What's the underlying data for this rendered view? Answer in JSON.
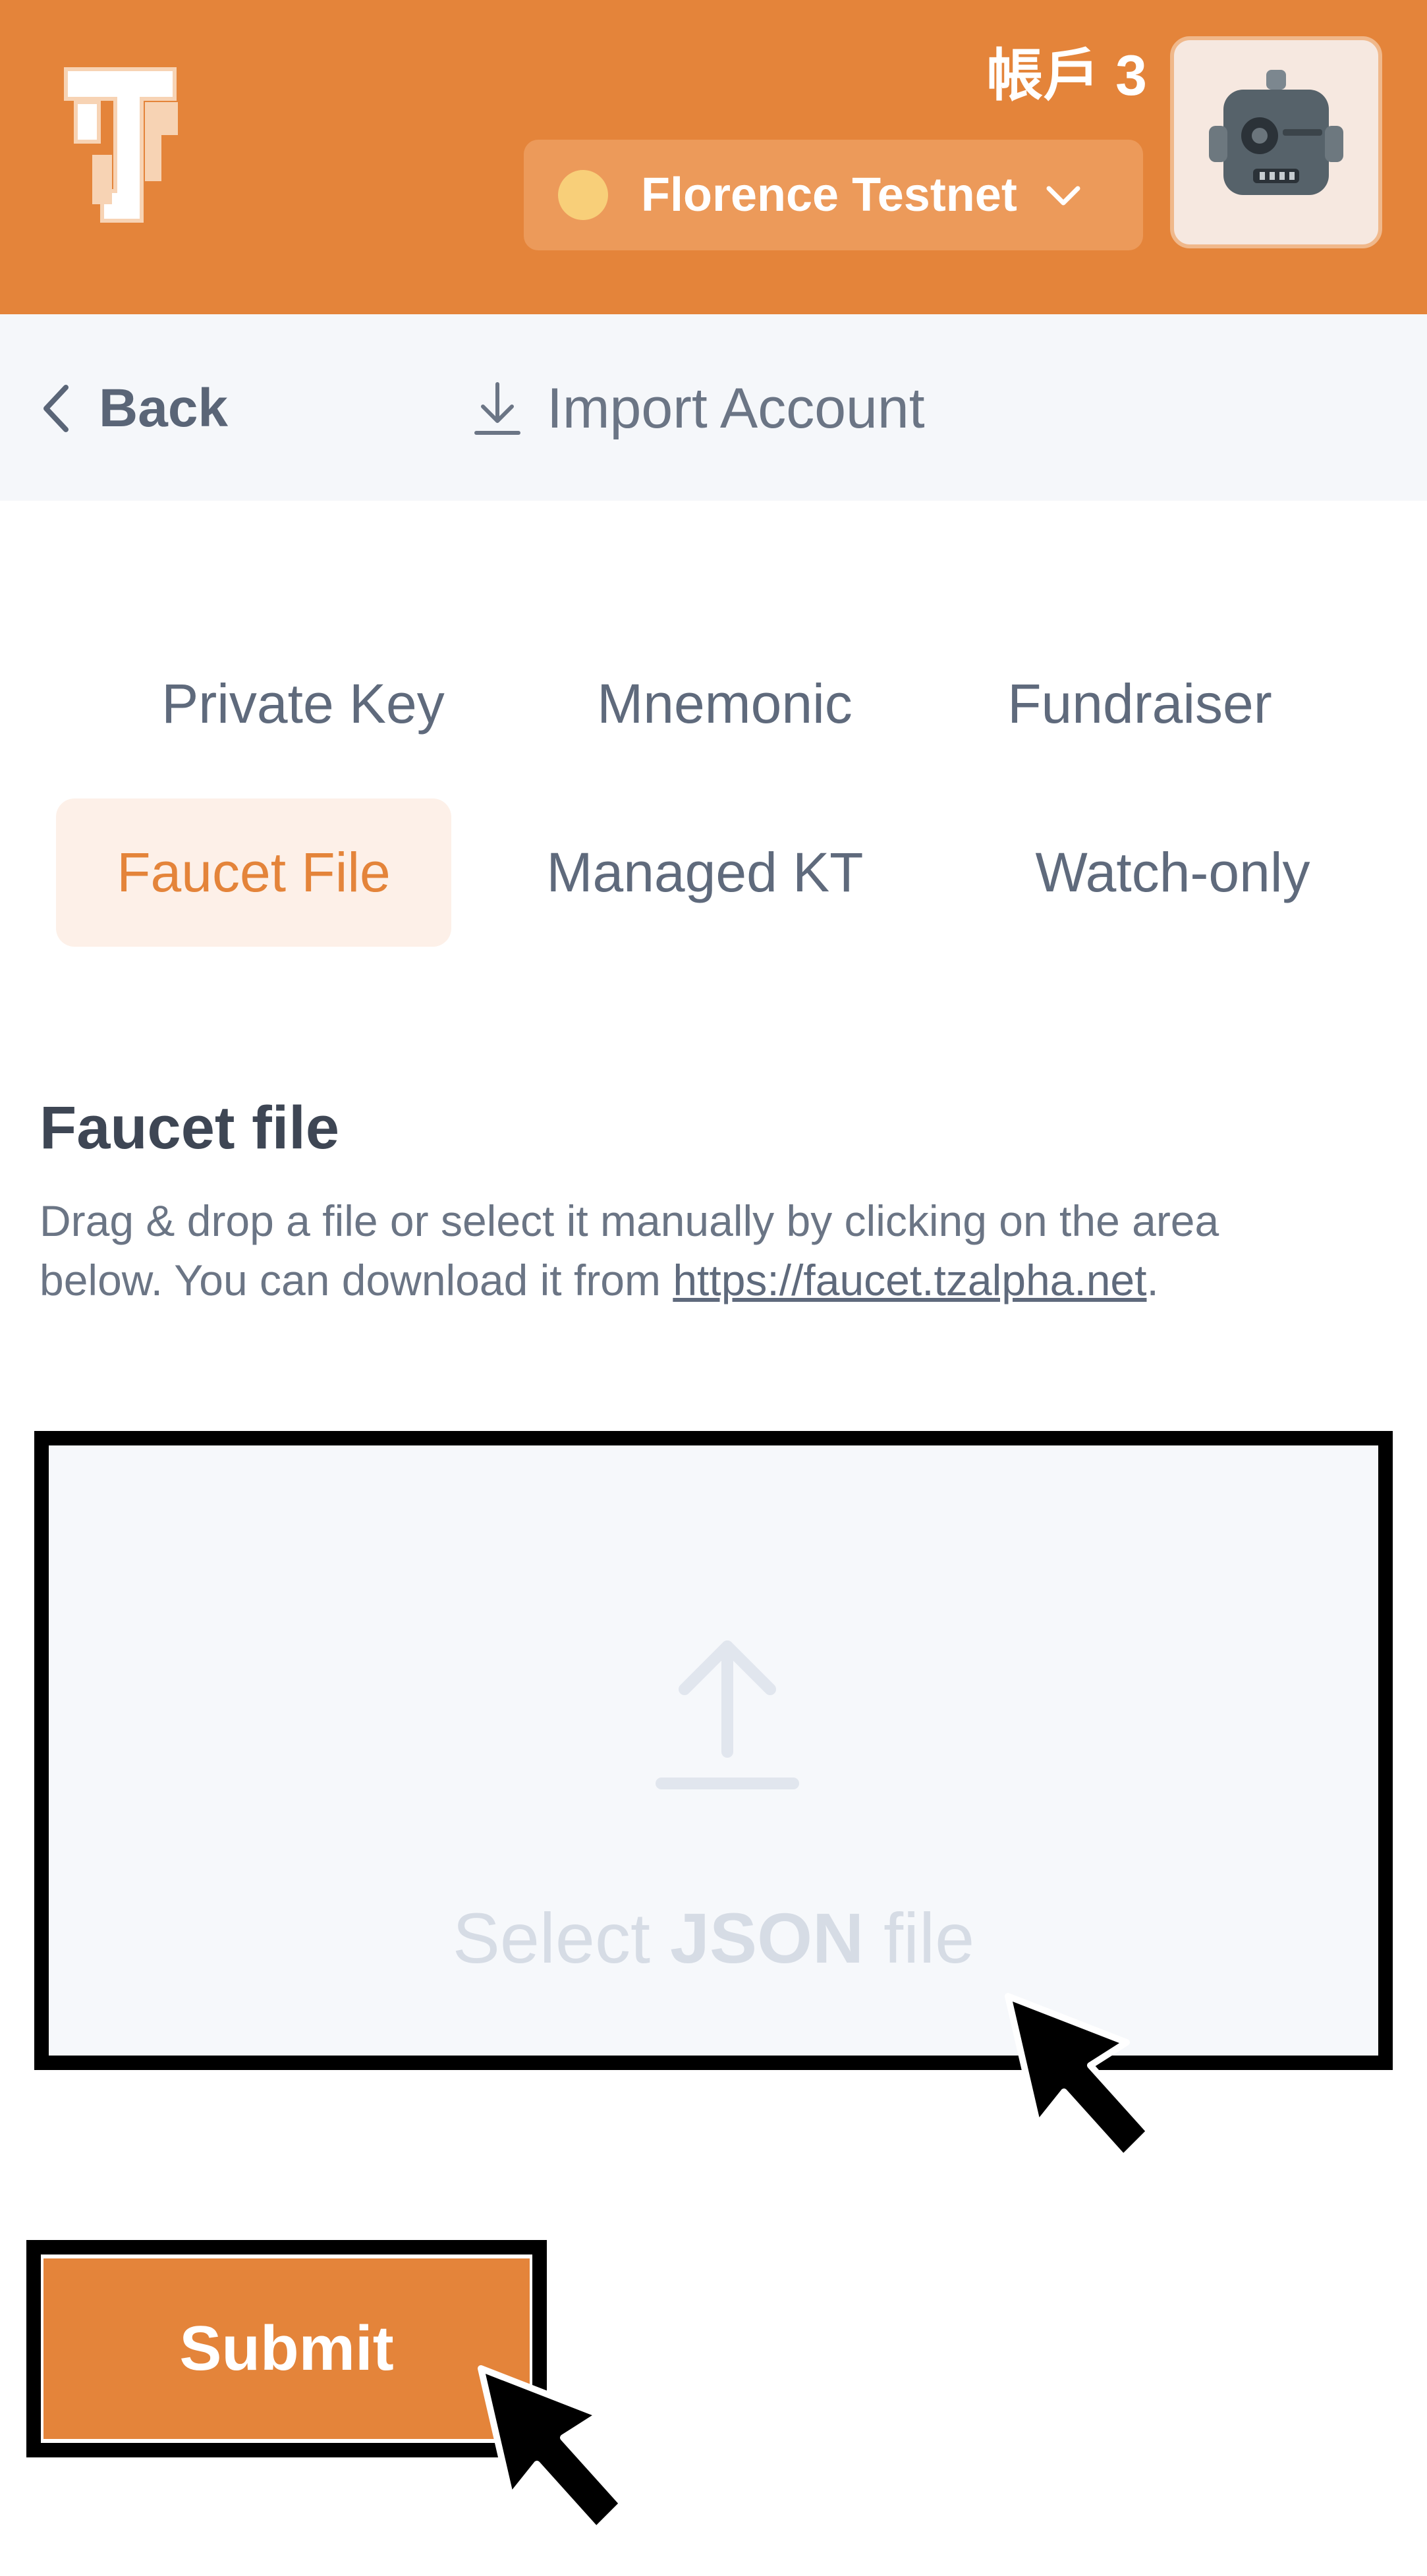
{
  "header": {
    "account_name": "帳戶 3",
    "network": {
      "label": "Florence Testnet",
      "status_color": "#F8CF79"
    },
    "brand_color": "#E4843A"
  },
  "nav": {
    "back_label": "Back",
    "title": "Import Account"
  },
  "tabs": [
    {
      "label": "Private Key",
      "active": false
    },
    {
      "label": "Mnemonic",
      "active": false
    },
    {
      "label": "Fundraiser",
      "active": false
    },
    {
      "label": "Faucet File",
      "active": true
    },
    {
      "label": "Managed KT",
      "active": false
    },
    {
      "label": "Watch-only",
      "active": false
    }
  ],
  "form": {
    "title": "Faucet file",
    "description_prefix": "Drag & drop a file or select it manually by clicking on the area below. You can download it from ",
    "description_link": "https://faucet.tzalpha.net",
    "description_suffix": ".",
    "dropzone": {
      "label_pre": "Select ",
      "label_bold": "JSON",
      "label_post": " file"
    },
    "submit_label": "Submit"
  }
}
